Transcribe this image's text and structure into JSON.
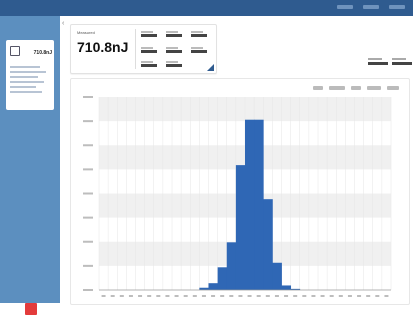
{
  "summary": {
    "label": "Measured",
    "value": "710.8nJ"
  },
  "sidebar": {
    "device_value": "710.8nJ"
  },
  "chart_data": {
    "type": "bar",
    "title": "",
    "xlabel": "",
    "ylabel": "",
    "ylim": [
      0,
      17
    ],
    "grid": true,
    "colors": {
      "bar": "#2f67b5",
      "band": "#f0f0f0"
    },
    "values": [
      0,
      0,
      0,
      0,
      0,
      0,
      0,
      0,
      0,
      0,
      0,
      0.2,
      0.6,
      2,
      4.2,
      11,
      15,
      15,
      8,
      2.4,
      0.4,
      0.1,
      0,
      0,
      0,
      0,
      0,
      0,
      0,
      0,
      0,
      0
    ]
  }
}
